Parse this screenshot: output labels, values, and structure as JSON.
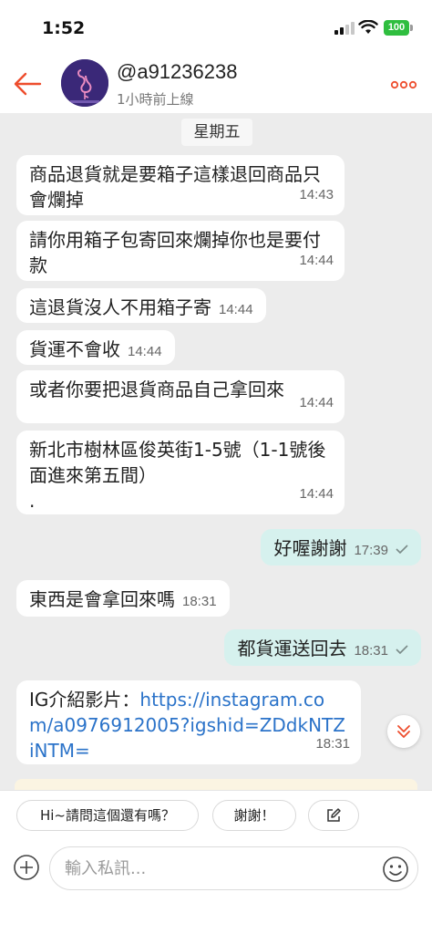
{
  "status_bar": {
    "time": "1:52",
    "battery": "100"
  },
  "header": {
    "contact_name": "@a91236238",
    "last_seen": "1小時前上線",
    "accent_color": "#ee4d2d"
  },
  "chat": {
    "day_separator": "星期五",
    "messages": [
      {
        "dir": "in",
        "text": "商品退貨就是要箱子這樣退回商品只會爛掉",
        "time": "14:43"
      },
      {
        "dir": "in",
        "text": "請你用箱子包寄回來爛掉你也是要付款",
        "time": "14:44"
      },
      {
        "dir": "in",
        "text": "這退貨沒人不用箱子寄",
        "time": "14:44"
      },
      {
        "dir": "in",
        "text": "貨運不會收",
        "time": "14:44"
      },
      {
        "dir": "in",
        "text": "或者你要把退貨商品自己拿回來",
        "time": "14:44"
      },
      {
        "dir": "in",
        "text": "新北市樹林區俊英街1-5號（1-1號後面進來第五間）",
        "text2": ".",
        "time": "14:44"
      },
      {
        "dir": "out",
        "text": "好喔謝謝",
        "time": "17:39"
      },
      {
        "dir": "in",
        "text": "東西是會拿回來嗎",
        "time": "18:31"
      },
      {
        "dir": "out",
        "text": "都貨運送回去",
        "time": "18:31"
      },
      {
        "dir": "in",
        "text": "IG介紹影片：",
        "link": "https://instagram.com/a0976912005?igshid=ZDdkNTZiNTM=",
        "time": "18:31"
      }
    ]
  },
  "quick_replies": [
    "Hi~請問這個還有嗎？",
    "謝謝！"
  ],
  "input": {
    "placeholder": "輸入私訊..."
  },
  "icons": {
    "back": "back-arrow-icon",
    "more": "more-dots-icon",
    "scroll": "double-chevron-down-icon",
    "edit": "edit-icon",
    "plus": "plus-circle-icon",
    "emoji": "smiley-icon"
  }
}
